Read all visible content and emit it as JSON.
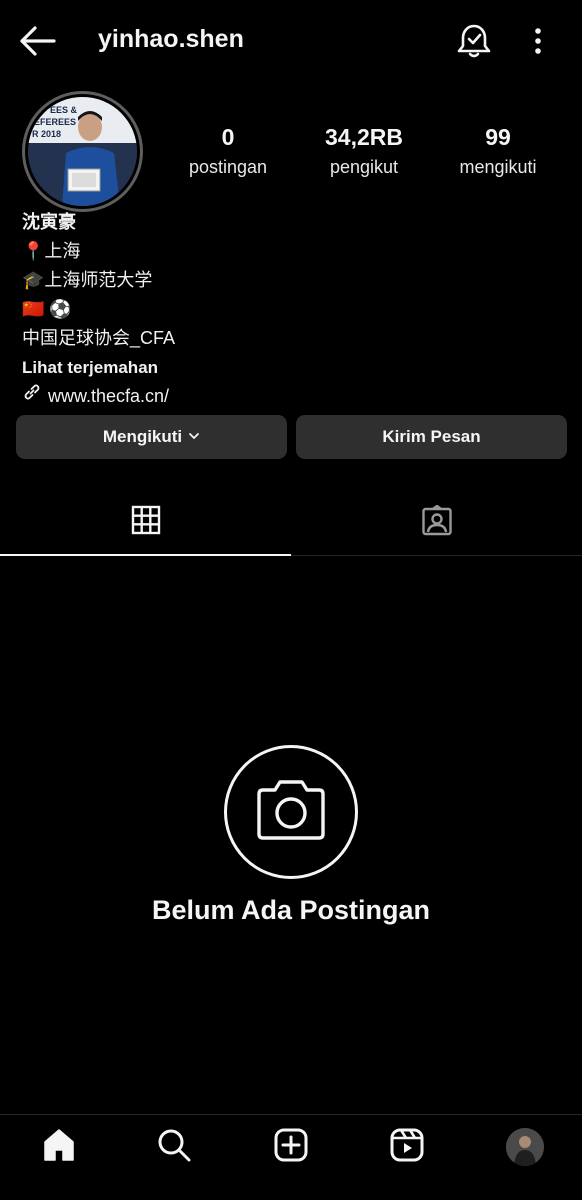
{
  "header": {
    "username": "yinhao.shen",
    "back_icon": "arrow-left-icon",
    "notifications_icon": "bell-icon",
    "more_icon": "more-vertical-icon"
  },
  "profile": {
    "avatar_icon": "profile-photo",
    "avatar_banner_text": [
      "EES &",
      "EFEREES",
      "R 2018"
    ],
    "stats": {
      "posts": {
        "value": "0",
        "label": "postingan"
      },
      "followers": {
        "value": "34,2RB",
        "label": "pengikut"
      },
      "following": {
        "value": "99",
        "label": "mengikuti"
      }
    }
  },
  "bio": {
    "name": "沈寅豪",
    "location": "📍上海",
    "school": "🎓上海师范大学",
    "emojis": "🇨🇳 ⚽",
    "org": "中国足球协会_CFA",
    "translate_label": "Lihat terjemahan",
    "link": "www.thecfa.cn/",
    "link_icon": "link-icon"
  },
  "actions": {
    "follow_label": "Mengikuti",
    "follow_icon": "chevron-down-icon",
    "message_label": "Kirim Pesan"
  },
  "tabs": [
    {
      "id": "grid",
      "icon": "grid-icon",
      "active": true
    },
    {
      "id": "tagged",
      "icon": "tagged-person-icon",
      "active": false
    }
  ],
  "empty_state": {
    "icon": "camera-icon",
    "text": "Belum Ada Postingan"
  },
  "bottom_nav": [
    {
      "id": "home",
      "icon": "home-icon"
    },
    {
      "id": "search",
      "icon": "search-icon"
    },
    {
      "id": "create",
      "icon": "add-icon"
    },
    {
      "id": "reels",
      "icon": "reels-icon"
    },
    {
      "id": "profile",
      "icon": "profile-avatar"
    }
  ],
  "colors": {
    "background": "#000000",
    "text": "#f5f5f5",
    "button_bg": "#2f2f2f",
    "divider": "#262626"
  }
}
